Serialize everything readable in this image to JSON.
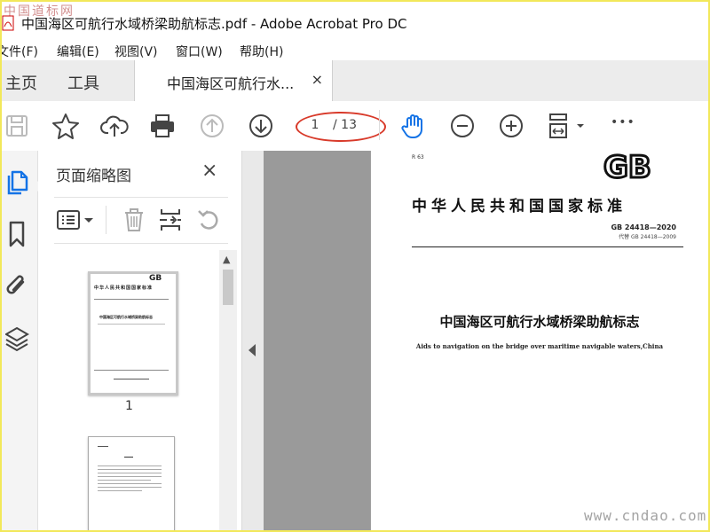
{
  "window": {
    "title": "中国海区可航行水域桥梁助航标志.pdf - Adobe Acrobat Pro DC",
    "watermark_top": "中国道标网"
  },
  "menu": {
    "items": [
      "文件(F)",
      "编辑(E)",
      "视图(V)",
      "窗口(W)",
      "帮助(H)"
    ]
  },
  "tabs": {
    "home": "主页",
    "tools": "工具",
    "document": "中国海区可航行水...",
    "close_glyph": "×"
  },
  "toolbar": {
    "current_page": "1",
    "total_pages": "/ 13",
    "more_glyph": "•••"
  },
  "panel": {
    "title": "页面缩略图",
    "close_glyph": "×",
    "thumb_page_1": "1"
  },
  "document": {
    "code": "R 63",
    "logo": "GB",
    "standard_header": "中华人民共和国国家标准",
    "gb_number": "GB 24418—2020",
    "replaces": "代替 GB 24418—2009",
    "title_cn": "中国海区可航行水域桥梁助航标志",
    "title_en": "Aids to navigation on the bridge over maritime navigable waters,China"
  },
  "watermark_bottom": "www.cndao.com",
  "colors": {
    "frame": "#f2e85a",
    "hand_tool": "#1473e6",
    "annotation_ring": "#d83a2a",
    "sidebar_active": "#1473e6"
  },
  "icons": {
    "toolbar": [
      "save-icon",
      "star-icon",
      "cloud-upload-icon",
      "print-icon",
      "page-up-icon",
      "page-down-icon",
      "hand-tool-icon",
      "zoom-out-icon",
      "zoom-in-icon",
      "page-view-icon",
      "more-icon"
    ],
    "rail": [
      "pages-icon",
      "bookmark-icon",
      "attachment-icon",
      "layers-icon"
    ],
    "panel": [
      "options-icon",
      "delete-icon",
      "insert-page-icon",
      "rotate-icon"
    ]
  }
}
